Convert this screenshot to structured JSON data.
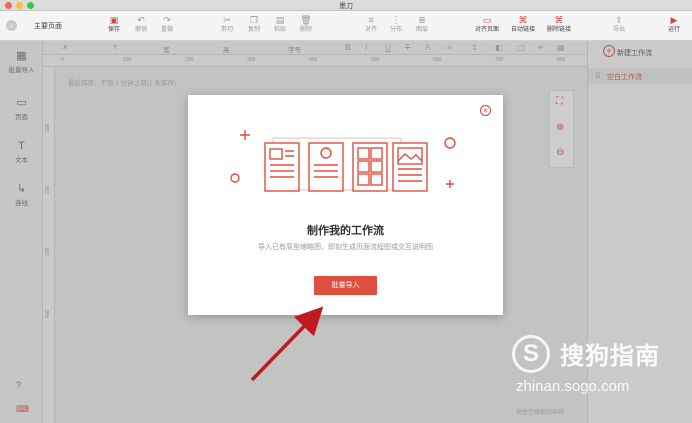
{
  "window": {
    "title": "墨刀"
  },
  "toolbar": {
    "page_tab": "主要页面",
    "buttons": [
      {
        "label": "保存",
        "icon": "save-icon",
        "glyph": "▣"
      },
      {
        "label": "撤销",
        "icon": "undo-icon",
        "glyph": "↶"
      },
      {
        "label": "重做",
        "icon": "redo-icon",
        "glyph": "↷"
      },
      {
        "label": "剪切",
        "icon": "cut-icon",
        "glyph": "✂"
      },
      {
        "label": "复制",
        "icon": "copy-icon",
        "glyph": "❐"
      },
      {
        "label": "粘贴",
        "icon": "paste-icon",
        "glyph": "▤"
      },
      {
        "label": "删除",
        "icon": "delete-icon",
        "glyph": "🗑"
      },
      {
        "label": "对齐",
        "icon": "align-icon",
        "glyph": "≡"
      },
      {
        "label": "分布",
        "icon": "distribute-icon",
        "glyph": "⋮"
      },
      {
        "label": "图层",
        "icon": "layers-icon",
        "glyph": "≣"
      },
      {
        "label": "对齐页面",
        "icon": "align-page-icon",
        "glyph": "▭"
      },
      {
        "label": "自动链接",
        "icon": "auto-link-icon",
        "glyph": "⌘"
      },
      {
        "label": "删除链接",
        "icon": "delete-link-icon",
        "glyph": "⌘"
      },
      {
        "label": "导出",
        "icon": "export-icon",
        "glyph": "⇪"
      },
      {
        "label": "运行",
        "icon": "run-icon",
        "glyph": "▶"
      }
    ]
  },
  "sidebar": {
    "items": [
      {
        "label": "批量导入",
        "icon": "batch-import-icon",
        "glyph": "▦"
      },
      {
        "label": "页面",
        "icon": "page-icon",
        "glyph": "▭"
      },
      {
        "label": "文本",
        "icon": "text-icon",
        "glyph": "T"
      },
      {
        "label": "连线",
        "icon": "connector-icon",
        "glyph": "↳"
      }
    ],
    "bottom_icons": [
      "help-icon",
      "keyboard-icon"
    ]
  },
  "properties": {
    "x": "X",
    "y": "Y",
    "width": "宽",
    "height": "高",
    "font_size": "字号"
  },
  "ruler": {
    "h_ticks": [
      "0",
      "100",
      "200",
      "300",
      "400",
      "500",
      "600",
      "700",
      "800"
    ],
    "v_ticks": [
      "100",
      "200",
      "300",
      "400"
    ]
  },
  "canvas": {
    "save_status": "最后保存：不到 1 分钟之前(1 未保存)"
  },
  "right_panel": {
    "new_flow": "新建工作流",
    "flows": [
      "空白工作流"
    ],
    "footer": "按住空格拖动画布"
  },
  "modal": {
    "title": "制作我的工作流",
    "description": "导入已有原型缩略图，即刻生成页面流程图或交互说明图",
    "button": "批量导入"
  },
  "watermark": {
    "logo": "S",
    "text": "搜狗指南",
    "url": "zhinan.sogo.com"
  },
  "colors": {
    "accent": "#e04e3f",
    "overlay": "rgba(120,120,120,0.35)",
    "annotation_arrow": "#c0191f"
  }
}
